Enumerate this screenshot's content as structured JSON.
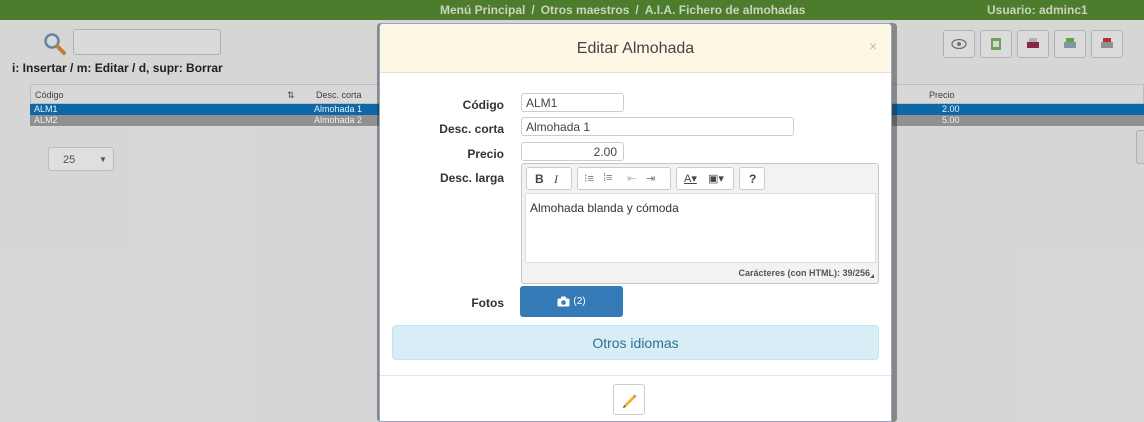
{
  "topbar": {
    "breadcrumb": [
      "Menú Principal",
      "Otros maestros",
      "A.I.A. Fichero de almohadas"
    ],
    "separator": "/",
    "user": "Usuario: adminc1"
  },
  "page": {
    "shortcuts": "i: Insertar / m: Editar / d, supr: Borrar",
    "search_value": "",
    "grid": {
      "columns": [
        "Código",
        "Desc. corta",
        "Precio"
      ],
      "rows": [
        {
          "codigo": "ALM1",
          "desc": "Almohada 1",
          "precio": "2.00",
          "selected": true
        },
        {
          "codigo": "ALM2",
          "desc": "Almohada 2",
          "precio": "5.00",
          "selected": false
        }
      ]
    },
    "page_size": "25",
    "toolbar_icons": [
      "eye-icon",
      "excel-icon",
      "print-icon",
      "print-green-icon",
      "print-red-icon"
    ]
  },
  "modal": {
    "title": "Editar Almohada",
    "close": "×",
    "fields": {
      "codigo_label": "Código",
      "codigo_value": "ALM1",
      "desc_corta_label": "Desc. corta",
      "desc_corta_value": "Almohada 1",
      "precio_label": "Precio",
      "precio_value": "2.00",
      "desc_larga_label": "Desc. larga",
      "desc_larga_value": "Almohada blanda y cómoda",
      "fotos_label": "Fotos"
    },
    "editor": {
      "bold": "B",
      "italic": "I",
      "help": "?",
      "char_count": "Carácteres (con HTML): 39/256"
    },
    "fotos_button": "(2)",
    "idiomas_button": "Otros idiomas"
  },
  "colors": {
    "topbar": "#4d7c2c",
    "selected_row": "#0c6fb4",
    "primary": "#337ab7",
    "header_bg": "#fcf8e3",
    "info_bg": "#d9edf7"
  }
}
